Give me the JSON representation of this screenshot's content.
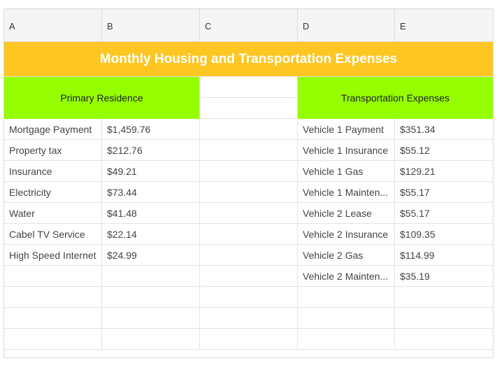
{
  "columns": [
    "A",
    "B",
    "C",
    "D",
    "E"
  ],
  "title": "Monthly Housing and Transportation Expenses",
  "sections": {
    "primary": "Primary Residence",
    "transport": "Transportation Expenses"
  },
  "housing": [
    {
      "item": "Mortgage Payment",
      "amount": "$1,459.76"
    },
    {
      "item": "Property tax",
      "amount": "$212.76"
    },
    {
      "item": "Insurance",
      "amount": "$49.21"
    },
    {
      "item": "Electricity",
      "amount": "$73.44"
    },
    {
      "item": "Water",
      "amount": "$41.48"
    },
    {
      "item": "Cabel TV Service",
      "amount": "$22.14"
    },
    {
      "item": "High Speed Internet",
      "amount": "$24.99"
    }
  ],
  "transportation": [
    {
      "item": "Vehicle 1 Payment",
      "amount": "$351.34"
    },
    {
      "item": "Vehicle 1 Insurance",
      "amount": "$55.12"
    },
    {
      "item": "Vehicle 1 Gas",
      "amount": "$129.21"
    },
    {
      "item": "Vehicle 1 Mainten...",
      "amount": "$55.17"
    },
    {
      "item": "Vehicle 2 Lease",
      "amount": "$55.17"
    },
    {
      "item": "Vehicle 2 Insurance",
      "amount": "$109.35"
    },
    {
      "item": "Vehicle 2 Gas",
      "amount": "$114.99"
    },
    {
      "item": "Vehicle 2 Mainten...",
      "amount": "$35.19"
    }
  ],
  "colors": {
    "title_bg": "#fdc623",
    "section_bg": "#95fe00",
    "header_bg": "#f5f5f5"
  }
}
